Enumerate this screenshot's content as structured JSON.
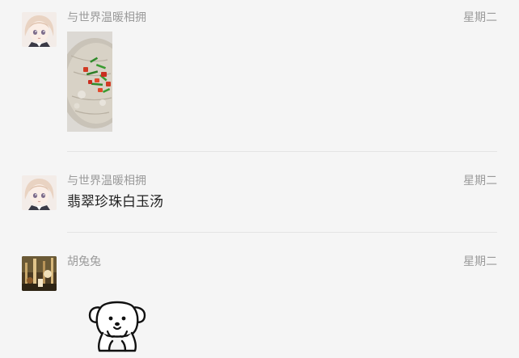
{
  "chats": [
    {
      "sender": "与世界温暖相拥",
      "time": "星期二",
      "type": "image",
      "image_icon": "food-photo",
      "avatar_icon": "anime-girl-avatar"
    },
    {
      "sender": "与世界温暖相拥",
      "time": "星期二",
      "type": "text",
      "text": "翡翠珍珠白玉汤",
      "avatar_icon": "anime-girl-avatar"
    },
    {
      "sender": "胡兔兔",
      "time": "星期二",
      "type": "sticker",
      "sticker_icon": "puppy-sticker",
      "avatar_icon": "photo-avatar"
    }
  ],
  "colors": {
    "background": "#f5f5f5",
    "meta_text": "#9a9a9a",
    "message_text": "#222222",
    "divider": "#e4e4e4"
  }
}
